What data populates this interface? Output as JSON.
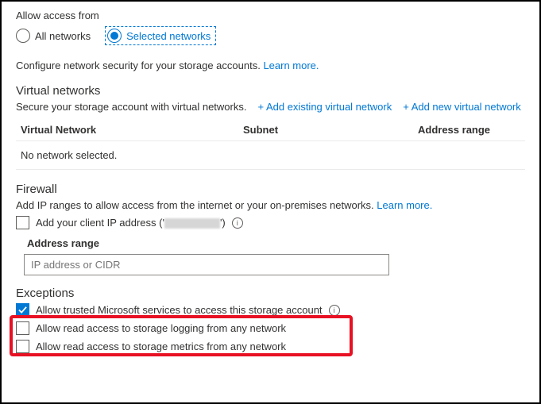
{
  "access": {
    "label": "Allow access from",
    "options": {
      "all": "All networks",
      "selected": "Selected networks"
    }
  },
  "configDesc": "Configure network security for your storage accounts.",
  "learnMore": "Learn more.",
  "vnet": {
    "heading": "Virtual networks",
    "desc": "Secure your storage account with virtual networks.",
    "addExisting": "+ Add existing virtual network",
    "addNew": "+ Add new virtual network",
    "columns": {
      "vn": "Virtual Network",
      "subnet": "Subnet",
      "range": "Address range"
    },
    "empty": "No network selected."
  },
  "firewall": {
    "heading": "Firewall",
    "desc": "Add IP ranges to allow access from the internet or your on-premises networks.",
    "addClient": "Add your client IP address (",
    "addClientClose": ")",
    "rangeLabel": "Address range",
    "placeholder": "IP address or CIDR"
  },
  "exceptions": {
    "heading": "Exceptions",
    "trusted": "Allow trusted Microsoft services to access this storage account",
    "logging": "Allow read access to storage logging from any network",
    "metrics": "Allow read access to storage metrics from any network"
  }
}
